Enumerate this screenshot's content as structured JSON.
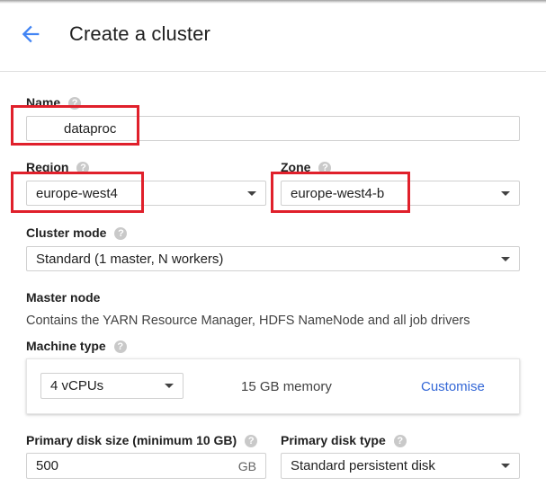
{
  "header": {
    "title": "Create a cluster",
    "back_icon": "arrow-back-icon",
    "accent": "#4285f4"
  },
  "form": {
    "name": {
      "label": "Name",
      "value": "dataproc"
    },
    "region": {
      "label": "Region",
      "value": "europe-west4"
    },
    "zone": {
      "label": "Zone",
      "value": "europe-west4-b"
    },
    "cluster_mode": {
      "label": "Cluster mode",
      "value": "Standard (1 master, N workers)"
    },
    "master_node": {
      "heading": "Master node",
      "description": "Contains the YARN Resource Manager, HDFS NameNode and all job drivers",
      "machine_type": {
        "label": "Machine type",
        "value": "4 vCPUs",
        "memory": "15 GB memory",
        "customise": "Customise"
      },
      "primary_disk_size": {
        "label": "Primary disk size (minimum 10 GB)",
        "value": "500",
        "unit": "GB"
      },
      "primary_disk_type": {
        "label": "Primary disk type",
        "value": "Standard persistent disk"
      }
    }
  },
  "help_icon_glyph": "?",
  "highlight_color": "#e0202b"
}
